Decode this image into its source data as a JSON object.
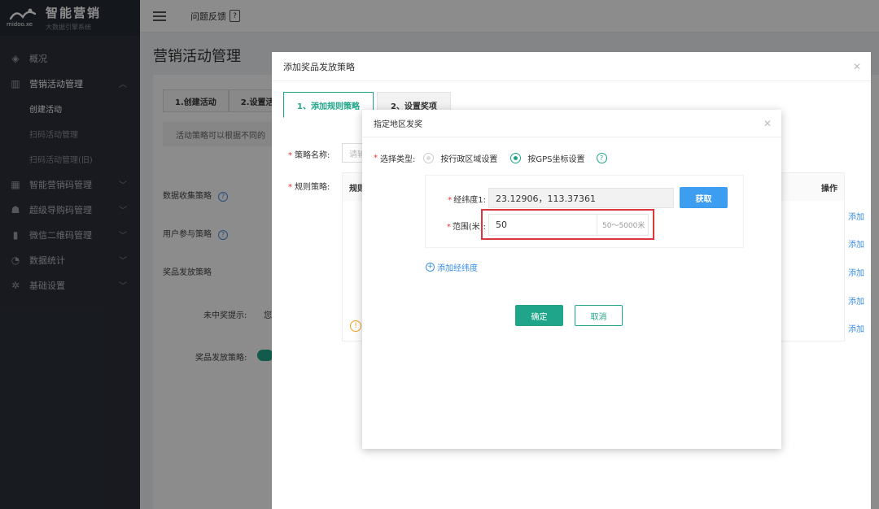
{
  "app": {
    "logo_title": "智能营销",
    "logo_subtitle": "大数据引擎系统",
    "logo_brand": "midoo.xe"
  },
  "header": {
    "feedback_label": "问题反馈"
  },
  "sidebar": {
    "items": [
      {
        "label": "概况",
        "icon": "layers-icon"
      },
      {
        "label": "营销活动管理",
        "icon": "chart-icon",
        "expanded": true
      },
      {
        "label": "智能营销码管理",
        "icon": "qrcode-icon"
      },
      {
        "label": "超级导购码管理",
        "icon": "users-icon"
      },
      {
        "label": "微信二维码管理",
        "icon": "barcode-icon"
      },
      {
        "label": "数据统计",
        "icon": "pie-icon"
      },
      {
        "label": "基础设置",
        "icon": "gear-icon"
      }
    ],
    "sub_items": [
      "创建活动",
      "扫码活动管理",
      "扫码活动管理(旧)"
    ]
  },
  "page": {
    "title": "营销活动管理",
    "steps": [
      "1.创建活动",
      "2.设置活"
    ],
    "tip": "活动策略可以根据不同的",
    "rows": [
      "数据收集策略",
      "用户参与策略",
      "奖品发放策略"
    ],
    "no_prize_label": "未中奖提示:",
    "no_prize_value": "您",
    "prize_strategy_label": "奖品发放策略:"
  },
  "dialog1": {
    "title": "添加奖品发放策略",
    "tabs": [
      "1、添加规则策略",
      "2、设置奖项"
    ],
    "name_label": "策略名称:",
    "name_placeholder": "请输",
    "rules_label": "规则策略:",
    "rules_header": "规则",
    "op_header": "操作",
    "op_links": [
      "添加",
      "添加",
      "添加",
      "添加",
      "添加"
    ]
  },
  "dialog2": {
    "title": "指定地区发奖",
    "type_label": "选择类型:",
    "options": [
      "按行政区域设置",
      "按GPS坐标设置"
    ],
    "selected_option": "按GPS坐标设置",
    "coord_label": "经纬度1:",
    "coord_value": "23.12906，113.37361",
    "fetch_label": "获取",
    "range_label": "范围(米):",
    "range_value": "50",
    "range_hint": "50～5000米",
    "add_coord_label": "添加经纬度",
    "ok_label": "确定",
    "cancel_label": "取消"
  },
  "colors": {
    "accent": "#1fa58a",
    "primary_blue": "#3d9df0",
    "highlight_red": "#d9363e",
    "sidebar_bg": "#2c313a"
  }
}
